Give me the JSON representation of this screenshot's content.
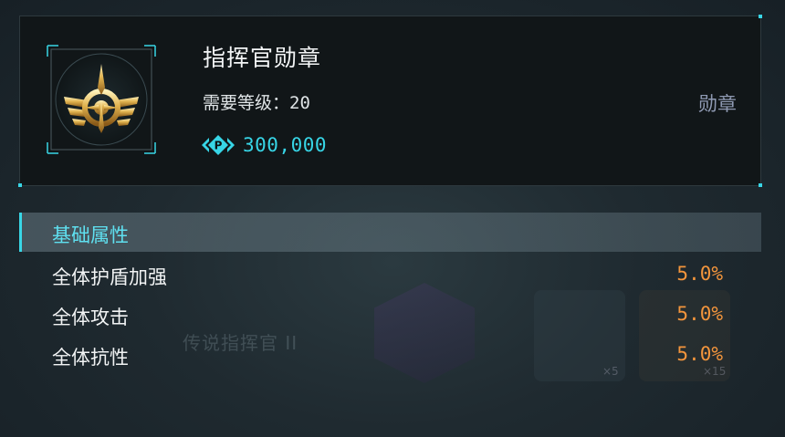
{
  "item": {
    "name": "指挥官勋章",
    "level_label": "需要等级：",
    "level_value": "20",
    "price": "300,000",
    "category": "勋章",
    "icon": "commander-medal-icon"
  },
  "attributes": {
    "section_title": "基础属性",
    "rows": [
      {
        "label": "全体护盾加强",
        "value": "5.0%"
      },
      {
        "label": "全体攻击",
        "value": "5.0%"
      },
      {
        "label": "全体抗性",
        "value": "5.0%"
      }
    ]
  },
  "background": {
    "faint_text": "传说指挥官 II",
    "count_1": "×5",
    "count_2": "×15"
  },
  "colors": {
    "accent_cyan": "#37d5e6",
    "value_orange": "#f3953c",
    "category_text": "#8f9ab3"
  }
}
